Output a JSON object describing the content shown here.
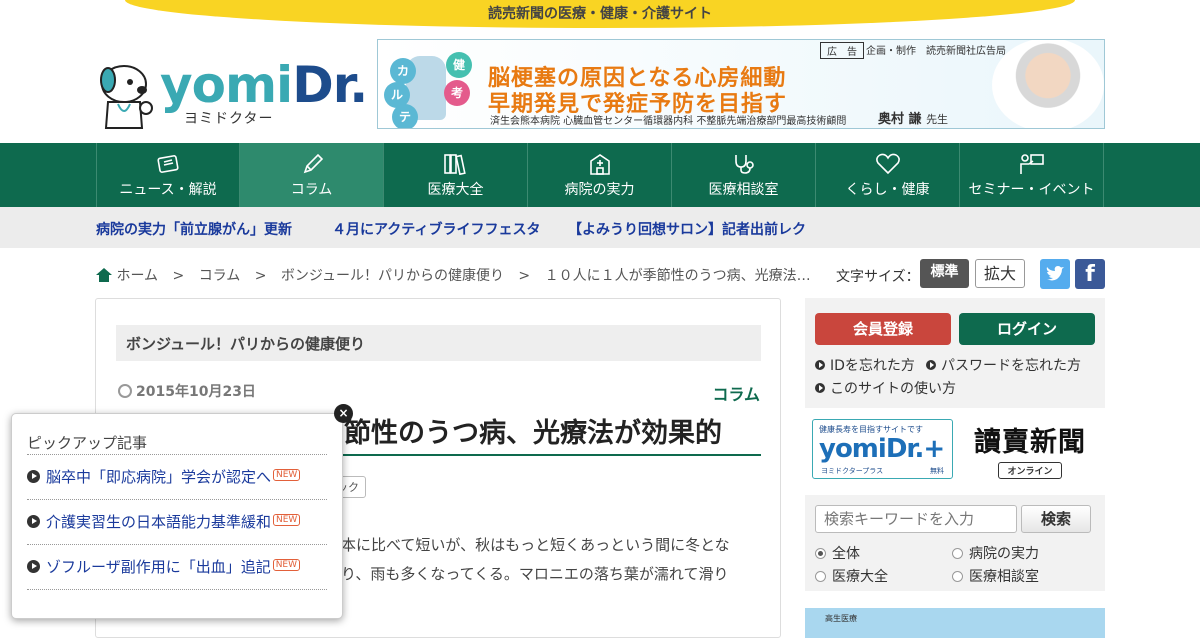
{
  "site": {
    "tagline": "読売新聞の医療・健康・介護サイト",
    "logo_main": "yomi",
    "logo_dr": "Dr.",
    "logo_sub": "ヨミドクター"
  },
  "header_ad": {
    "label": "広　告",
    "sponsor": "企画・制作　読売新聞社広告局",
    "line1": "脳梗塞の原因となる心房細動",
    "line2": "早期発見で発症予防を目指す",
    "credit": "済生会熊本病院 心臓血管センター循環器内科 不整脈先端治療部門最高技術顧問",
    "doctor_name": "奥村 謙",
    "doctor_suffix": "先生",
    "bubbles": [
      "カ",
      "ル",
      "テ",
      "健",
      "考"
    ]
  },
  "nav": [
    {
      "label": "ニュース・解説",
      "icon": "news-icon"
    },
    {
      "label": "コラム",
      "icon": "pen-icon"
    },
    {
      "label": "医療大全",
      "icon": "books-icon"
    },
    {
      "label": "病院の実力",
      "icon": "hospital-icon"
    },
    {
      "label": "医療相談室",
      "icon": "stethoscope-icon"
    },
    {
      "label": "くらし・健康",
      "icon": "heart-icon"
    },
    {
      "label": "セミナー・イベント",
      "icon": "presenter-icon"
    }
  ],
  "ticker": [
    "病院の実力「前立腺がん」更新",
    "４月にアクティブライフフェスタ",
    "【よみうり回想サロン】記者出前レク"
  ],
  "breadcrumb": {
    "home": "ホーム",
    "sep": ">",
    "items": [
      "コラム",
      "ボンジュール！パリからの健康便り",
      "１０人に１人が季節性のうつ病、光療法…"
    ]
  },
  "font_size": {
    "label": "文字サイズ：",
    "standard": "標準",
    "large": "拡大"
  },
  "social": {
    "facebook": "f"
  },
  "article": {
    "series": "ボンジュール！パリからの健康便り",
    "date": "2015年10月23日",
    "category": "コラム",
    "headline": "節性のうつ病、光療法が効果的",
    "tag": "ック",
    "body_line1": "本に比べて短いが、秋はもっと短くあっという間に冬とな",
    "body_line2": "り、雨も多くなってくる。マロニエの落ち葉が濡れて滑り"
  },
  "member": {
    "register": "会員登録",
    "login": "ログイン",
    "forgot_id": "IDを忘れた方",
    "forgot_pw": "パスワードを忘れた方",
    "howto": "このサイトの使い方"
  },
  "yomidr_plus": {
    "small": "健康長寿を目指すサイトです",
    "logo": "yomiDr.+",
    "sub": "ヨミドクタープラス",
    "free": "無料"
  },
  "yomiuri": {
    "name": "讀賣新聞",
    "online": "オンライン"
  },
  "search": {
    "placeholder": "検索キーワードを入力",
    "button": "検索",
    "options": [
      "全体",
      "病院の実力",
      "医療大全",
      "医療相談室"
    ],
    "selected": "全体"
  },
  "portal": {
    "text": "高生医療"
  },
  "pickup": {
    "title": "ピックアップ記事",
    "close": "×",
    "badge": "NEW",
    "items": [
      "脳卒中「即応病院」学会が認定へ",
      "介護実習生の日本語能力基準緩和",
      "ゾフルーザ副作用に「出血」追記"
    ]
  },
  "colors": {
    "brand_green": "#0e6a4e",
    "banner_yellow": "#f9d423",
    "link_blue": "#1a3a9c",
    "register_red": "#c9463d"
  }
}
